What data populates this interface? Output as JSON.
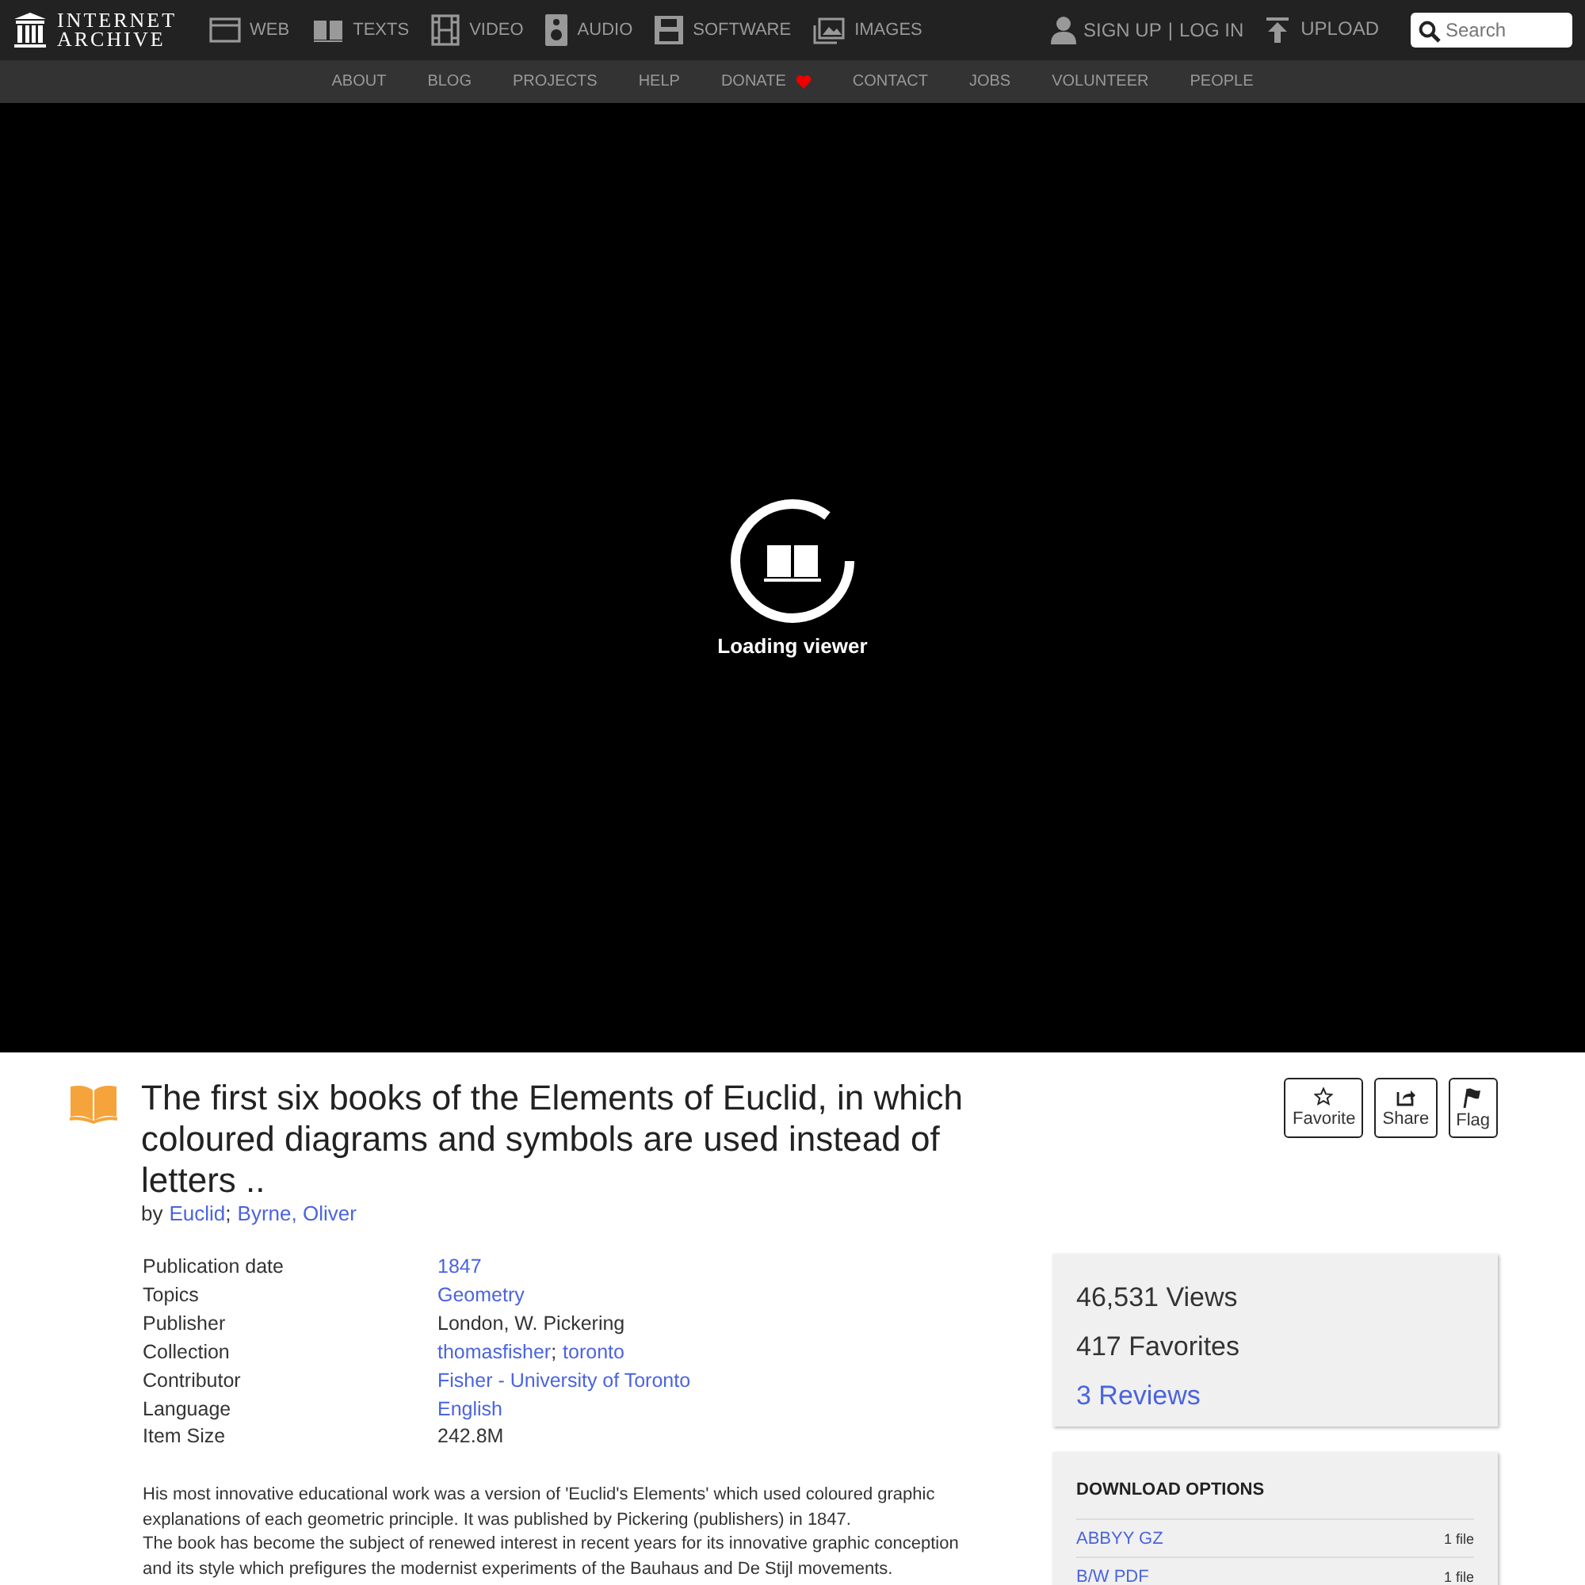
{
  "logo": {
    "line1": "INTERNET",
    "line2": "ARCHIVE"
  },
  "media_nav": [
    {
      "kind": "web",
      "label": "WEB"
    },
    {
      "kind": "texts",
      "label": "TEXTS"
    },
    {
      "kind": "video",
      "label": "VIDEO"
    },
    {
      "kind": "audio",
      "label": "AUDIO"
    },
    {
      "kind": "software",
      "label": "SOFTWARE"
    },
    {
      "kind": "images",
      "label": "IMAGES"
    }
  ],
  "account": {
    "sign_up": "SIGN UP",
    "separator": "|",
    "log_in": "LOG IN",
    "upload": "UPLOAD"
  },
  "search": {
    "placeholder": "Search"
  },
  "sub_nav": [
    {
      "label": "ABOUT",
      "heart": false
    },
    {
      "label": "BLOG",
      "heart": false
    },
    {
      "label": "PROJECTS",
      "heart": false
    },
    {
      "label": "HELP",
      "heart": false
    },
    {
      "label": "DONATE",
      "heart": true
    },
    {
      "label": "CONTACT",
      "heart": false
    },
    {
      "label": "JOBS",
      "heart": false
    },
    {
      "label": "VOLUNTEER",
      "heart": false
    },
    {
      "label": "PEOPLE",
      "heart": false
    }
  ],
  "viewer": {
    "status": "Loading viewer"
  },
  "item": {
    "title": "The first six books of the Elements of Euclid, in which coloured diagrams and symbols are used instead of letters ..",
    "by": "by",
    "authors": [
      "Euclid",
      "Byrne, Oliver"
    ],
    "author_separator": ";",
    "value_separator": ";",
    "actions": [
      {
        "kind": "favorite",
        "label": "Favorite"
      },
      {
        "kind": "share",
        "label": "Share"
      },
      {
        "kind": "flag",
        "label": "Flag"
      }
    ],
    "metadata": [
      {
        "label": "Publication date",
        "values": [
          {
            "text": "1847",
            "link": true
          }
        ]
      },
      {
        "label": "Topics",
        "values": [
          {
            "text": "Geometry",
            "link": true
          }
        ]
      },
      {
        "label": "Publisher",
        "values": [
          {
            "text": "London, W. Pickering",
            "link": false
          }
        ]
      },
      {
        "label": "Collection",
        "values": [
          {
            "text": "thomasfisher",
            "link": true
          },
          {
            "text": "toronto",
            "link": true
          }
        ]
      },
      {
        "label": "Contributor",
        "values": [
          {
            "text": "Fisher - University of Toronto",
            "link": true
          }
        ]
      },
      {
        "label": "Language",
        "values": [
          {
            "text": "English",
            "link": true
          }
        ]
      },
      {
        "label": "Item Size",
        "values": [
          {
            "text": "242.8M",
            "link": false
          }
        ]
      }
    ],
    "description": [
      "His most innovative educational work was a version of 'Euclid's Elements' which used coloured graphic explanations of each geometric principle. It was published by Pickering (publishers) in 1847.",
      "The book has become the subject of renewed interest in recent years for its innovative graphic conception and its style which prefigures the modernist experiments of the Bauhaus and De Stijl movements."
    ]
  },
  "stats": [
    {
      "text": "46,531 Views",
      "link": false
    },
    {
      "text": "417 Favorites",
      "link": false
    },
    {
      "text": "3 Reviews",
      "link": true
    }
  ],
  "downloads": {
    "title": "DOWNLOAD OPTIONS",
    "rows": [
      {
        "format": "ABBYY GZ",
        "count": "1 file"
      },
      {
        "format": "B/W PDF",
        "count": "1 file"
      }
    ]
  }
}
